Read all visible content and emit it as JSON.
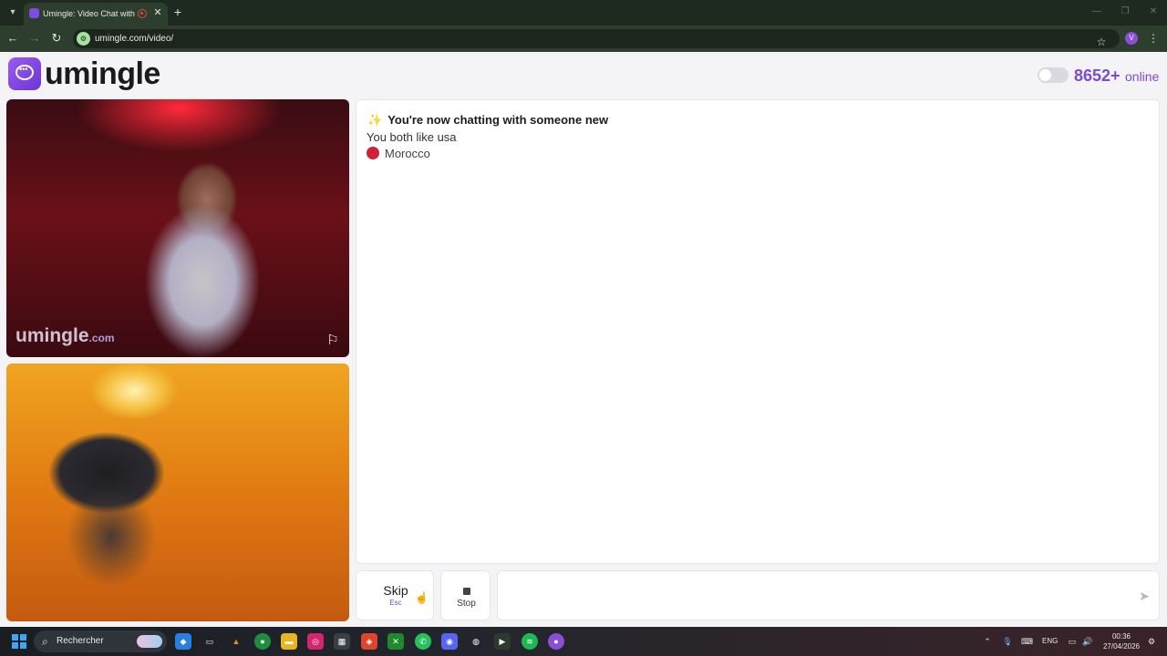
{
  "browser": {
    "tab_title": "Umingle: Video Chat with S",
    "url": "umingle.com/video/",
    "profile_initial": "V"
  },
  "header": {
    "logo_text": "umingle",
    "online_count": "8652+",
    "online_label": "online"
  },
  "video": {
    "watermark": "umingle",
    "watermark_suffix": ".com"
  },
  "chat": {
    "title": "You're now chatting with someone new",
    "common_interest": "You both like usa",
    "country": "Morocco"
  },
  "controls": {
    "skip_label": "Skip",
    "skip_key": "Esc",
    "stop_label": "Stop",
    "message_placeholder": ""
  },
  "taskbar": {
    "search_text": "Rechercher",
    "language": "ENG",
    "time": "00:36",
    "date": "27/04/2026"
  },
  "colors": {
    "brand": "#7b4ad8",
    "chrome": "#2d3d2e",
    "flag": "#d0213a"
  }
}
